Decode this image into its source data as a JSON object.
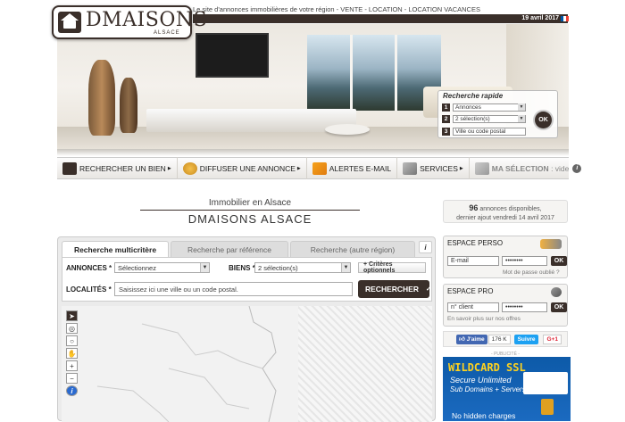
{
  "header": {
    "tagline": "Le site d'annonces immobilières de votre région - VENTE - LOCATION - LOCATION VACANCES",
    "date": "19 avril 2017",
    "logo_text": "DMAISONS",
    "logo_sub": "ALSACE"
  },
  "colors": {
    "brand_dark": "#3a2f2a",
    "facebook": "#4267b2",
    "twitter": "#1da1f2",
    "ad_blue": "#0d5aa8",
    "ad_yellow": "#ffd21e"
  },
  "quick_search": {
    "title": "Recherche rapide",
    "rows": [
      {
        "num": "1",
        "value": "Annonces"
      },
      {
        "num": "2",
        "value": "2 sélection(s)"
      },
      {
        "num": "3",
        "value": "Ville ou code postal"
      }
    ],
    "ok_label": "OK"
  },
  "nav": {
    "items": [
      {
        "label": "RECHERCHER UN BIEN",
        "icon": "house-icon"
      },
      {
        "label": "DIFFUSER UNE ANNONCE",
        "icon": "megaphone-icon"
      },
      {
        "label": "ALERTES E-MAIL",
        "icon": "envelope-icon"
      },
      {
        "label": "SERVICES",
        "icon": "hand-icon"
      }
    ],
    "selection_label": "MA SÉLECTION",
    "selection_status": ": vide",
    "info_icon": "i"
  },
  "main": {
    "heading_small": "Immobilier en Alsace",
    "heading_big": "Dmaisons alsace"
  },
  "counter": {
    "count": "96",
    "line1_rest": "annonces disponibles,",
    "line2": "dernier ajout vendredi 14 avril 2017"
  },
  "search_panel": {
    "tabs": [
      "Recherche multicritère",
      "Recherche par référence",
      "Recherche (autre région)"
    ],
    "info": "i",
    "annonces_label": "ANNONCES",
    "annonces_value": "Sélectionnez",
    "biens_label": "BIENS",
    "biens_value": "2 sélection(s)",
    "criteres_label": "+ Critères optionnels",
    "localites_label": "LOCALITÉS",
    "localites_placeholder": "Saisissez ici une ville ou un code postal.",
    "required_mark": "*",
    "search_button": "RECHERCHER"
  },
  "espace_perso": {
    "title": "ESPACE PERSO",
    "email_placeholder": "E-mail",
    "password_mask": "••••••••",
    "ok": "OK",
    "forgot": "Mot de passe oublié ?"
  },
  "espace_pro": {
    "title": "ESPACE PRO",
    "client_placeholder": "n° client",
    "password_mask": "••••••••",
    "ok": "OK",
    "info_link": "En savoir plus sur nos offres"
  },
  "social": {
    "fb_label": "J'aime",
    "fb_count": "176 K",
    "tw_label": "Suivre",
    "gp_label": "G+1"
  },
  "ad": {
    "pub_label": "- PUBLICITÉ -",
    "title": "WILDCARD SSL",
    "line1": "Secure Unlimited",
    "line2": "Sub Domains + Servers",
    "line3": "No hidden charges"
  }
}
